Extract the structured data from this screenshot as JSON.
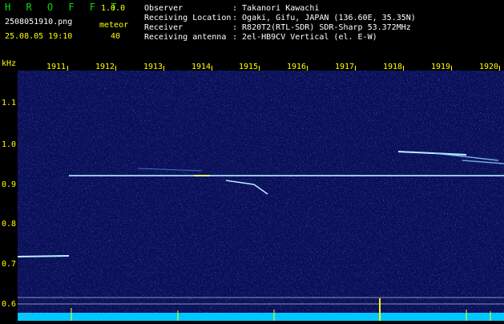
{
  "header": {
    "app_title": "H R O F F T",
    "app_version": "1.0.0",
    "file_name": "2508051910.png",
    "meteor_label": "meteor",
    "date_time": "25.08.05 19:10",
    "meteor_count": "40",
    "info": [
      {
        "label": "Observer",
        "value": ": Takanori Kawachi"
      },
      {
        "label": "Receiving Location",
        "value": ": Ogaki, Gifu, JAPAN (136.60E, 35.35N)"
      },
      {
        "label": "Receiver",
        "value": ": R820T2(RTL-SDR) SDR-Sharp 53.372MHz"
      },
      {
        "label": "Receiving antenna",
        "value": ": 2el-HB9CV Vertical (el. E-W)"
      }
    ]
  },
  "axis": {
    "unit": "kHz",
    "time_ticks": [
      "1911",
      "1912",
      "1913",
      "1914",
      "1915",
      "1916",
      "1917",
      "1918",
      "1919",
      "1920"
    ],
    "freq_ticks": [
      "1.1",
      "1.0",
      "0.9",
      "0.8",
      "0.7",
      "0.6"
    ]
  },
  "colors": {
    "text_yellow": "#ffff00",
    "text_green": "#00e000",
    "background": "#0a1058",
    "signal": "#b8f0ff"
  }
}
